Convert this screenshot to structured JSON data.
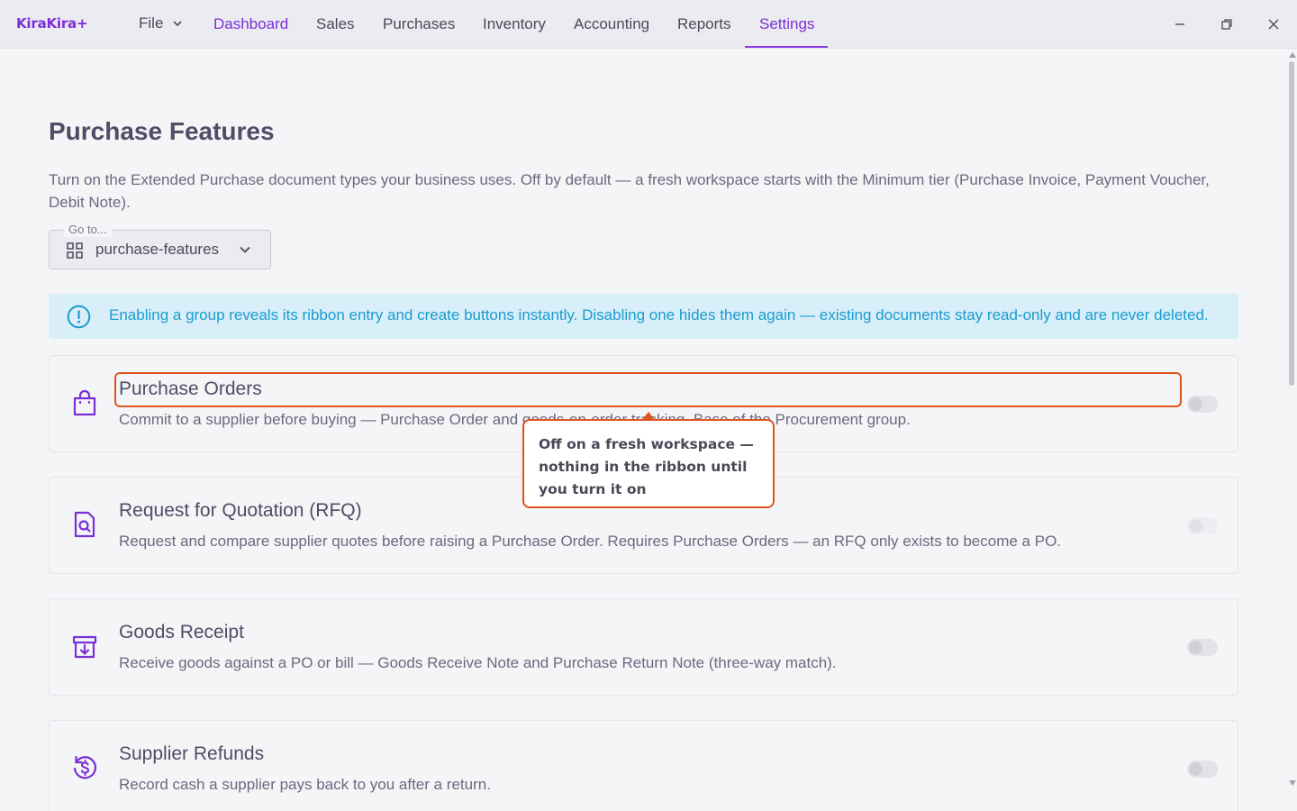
{
  "app": {
    "logo": "KiraKira+"
  },
  "nav": {
    "file": "File",
    "items": [
      {
        "label": "Dashboard",
        "state": "highlighted"
      },
      {
        "label": "Sales"
      },
      {
        "label": "Purchases"
      },
      {
        "label": "Inventory"
      },
      {
        "label": "Accounting"
      },
      {
        "label": "Reports"
      },
      {
        "label": "Settings",
        "state": "active"
      }
    ]
  },
  "window_controls": [
    "minimize-icon",
    "restore-icon",
    "close-icon"
  ],
  "page": {
    "title": "Purchase Features",
    "description": "Turn on the Extended Purchase document types your business uses. Off by default — a fresh workspace starts with the Minimum tier (Purchase Invoice, Payment Voucher, Debit Note).",
    "goto": {
      "legend": "Go to...",
      "value": "purchase-features"
    },
    "info": "Enabling a group reveals its ribbon entry and create buttons instantly. Disabling one hides them again — existing documents stay read-only and are never deleted."
  },
  "features": [
    {
      "title": "Purchase Orders",
      "description": "Commit to a supplier before buying — Purchase Order and goods-on-order tracking. Base of the Procurement group.",
      "icon": "shopping-bag-icon",
      "enabled": false
    },
    {
      "title": "Request for Quotation (RFQ)",
      "description": "Request and compare supplier quotes before raising a Purchase Order. Requires Purchase Orders — an RFQ only exists to become a PO.",
      "icon": "document-search-icon",
      "enabled": false,
      "disabled": true
    },
    {
      "title": "Goods Receipt",
      "description": "Receive goods against a PO or bill — Goods Receive Note and Purchase Return Note (three-way match).",
      "icon": "archive-download-icon",
      "enabled": false
    },
    {
      "title": "Supplier Refunds",
      "description": "Record cash a supplier pays back to you after a return.",
      "icon": "refund-dollar-icon",
      "enabled": false
    }
  ],
  "callout": {
    "text": "Off on a fresh workspace — nothing in the ribbon until you turn it on"
  },
  "colors": {
    "accent": "#7b2fd6",
    "highlight": "#e0531c",
    "info_text": "#1a9ccf",
    "info_bg": "#d8eef8"
  }
}
